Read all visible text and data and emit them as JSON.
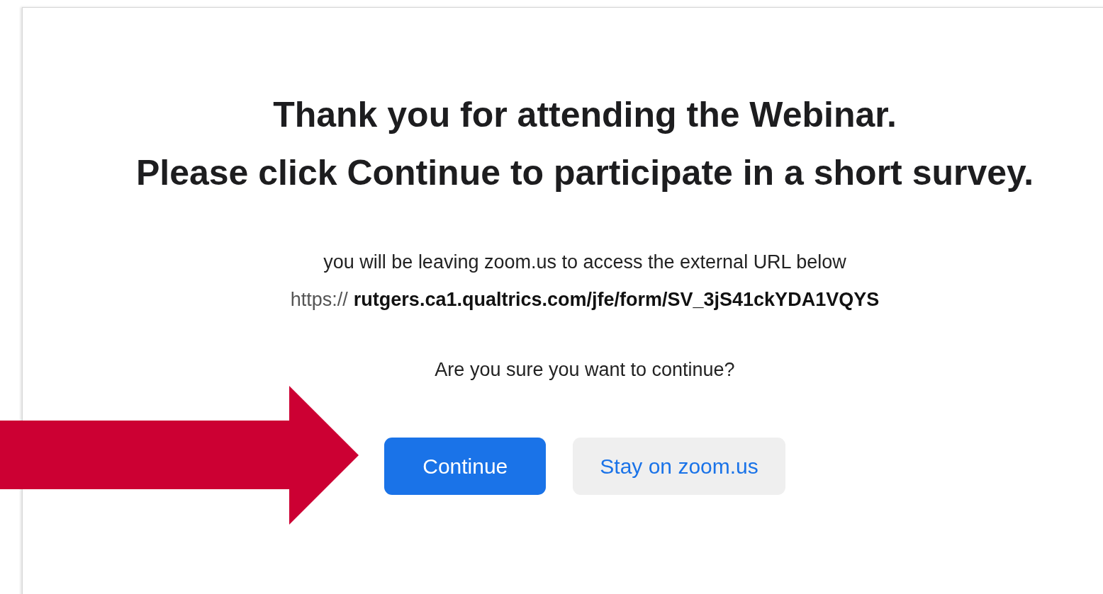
{
  "heading": [
    "Thank you for attending the Webinar.",
    "Please click Continue to participate in a short survey."
  ],
  "notice": "you will be leaving zoom.us to access the external URL below",
  "url": {
    "scheme": "https://",
    "address": "rutgers.ca1.qualtrics.com/jfe/form/SV_3jS41ckYDA1VQYS"
  },
  "question": "Are you sure you want to continue?",
  "buttons": [
    {
      "label": "Continue",
      "kind": "primary"
    },
    {
      "label": "Stay on zoom.us",
      "kind": "secondary"
    }
  ]
}
